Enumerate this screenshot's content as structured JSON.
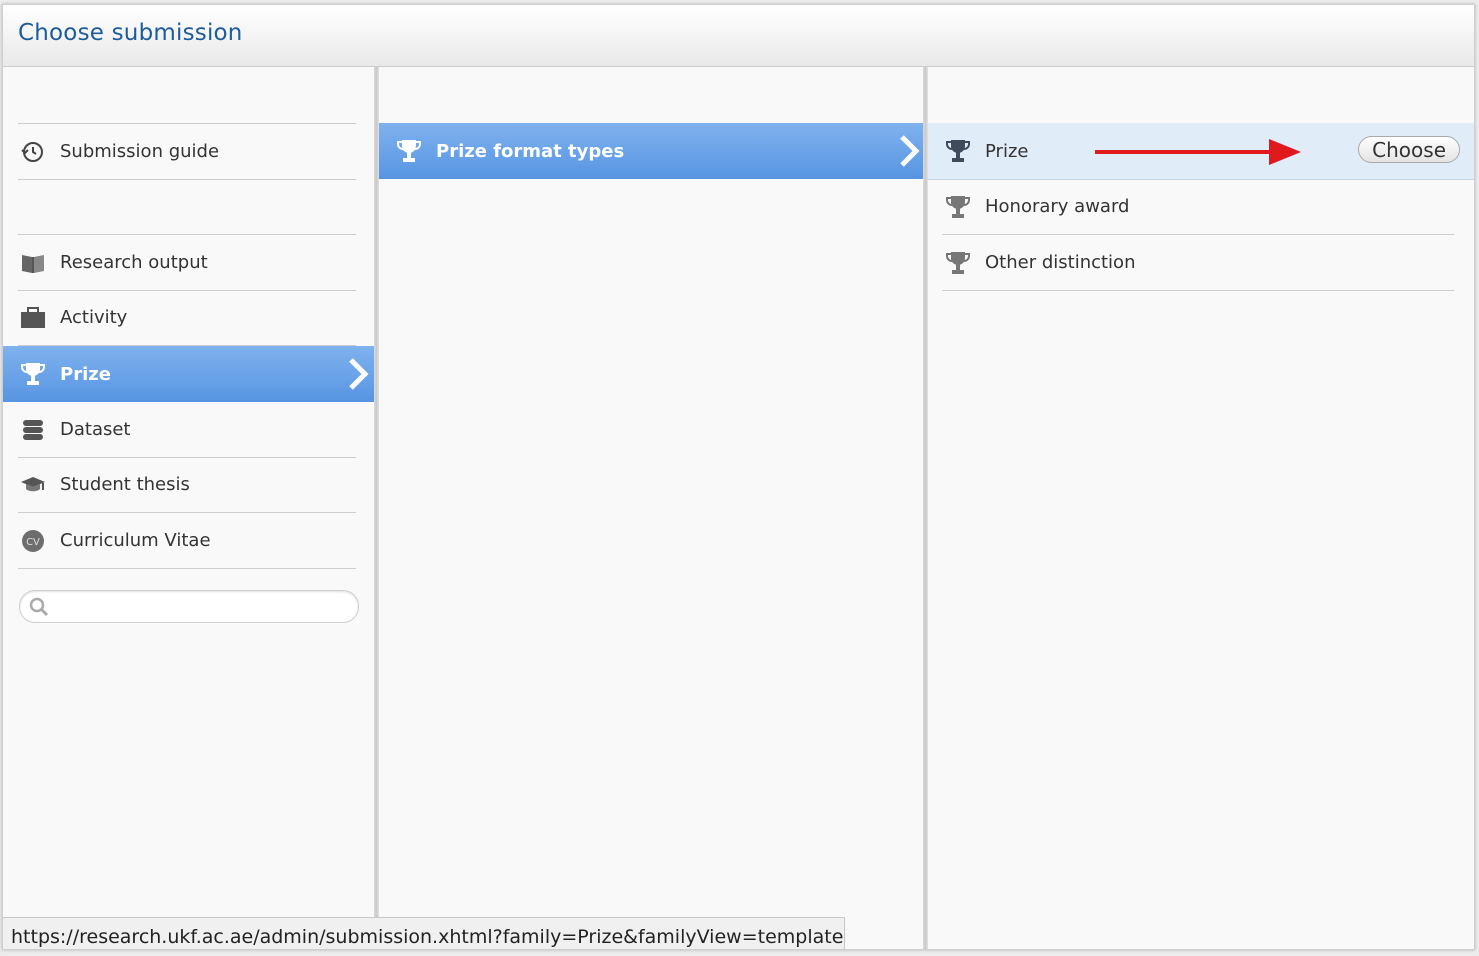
{
  "dialog": {
    "title": "Choose submission"
  },
  "sidebar": {
    "items": [
      {
        "label": "Submission guide",
        "icon": "history-icon"
      },
      {
        "label": "Research output",
        "icon": "book-icon"
      },
      {
        "label": "Activity",
        "icon": "briefcase-icon"
      },
      {
        "label": "Prize",
        "icon": "trophy-icon",
        "selected": true
      },
      {
        "label": "Dataset",
        "icon": "database-icon"
      },
      {
        "label": "Student thesis",
        "icon": "graduation-cap-icon"
      },
      {
        "label": "Curriculum Vitae",
        "icon": "cv-icon"
      }
    ],
    "search": {
      "value": "",
      "placeholder": ""
    }
  },
  "middle": {
    "items": [
      {
        "label": "Prize format types",
        "icon": "trophy-icon",
        "selected": true
      }
    ]
  },
  "right": {
    "items": [
      {
        "label": "Prize",
        "icon": "trophy-icon",
        "selected": true
      },
      {
        "label": "Honorary award",
        "icon": "trophy-icon"
      },
      {
        "label": "Other distinction",
        "icon": "trophy-icon"
      }
    ],
    "choose_label": "Choose"
  },
  "annotation": {
    "arrow_color": "#e0191f"
  },
  "colors": {
    "accent": "#5795e2",
    "title": "#1d5c9c",
    "selection_light": "#e1ecf9"
  },
  "statusbar": {
    "url": "https://research.ukf.ac.ae/admin/submission.xhtml?family=Prize&familyView=templates#"
  }
}
